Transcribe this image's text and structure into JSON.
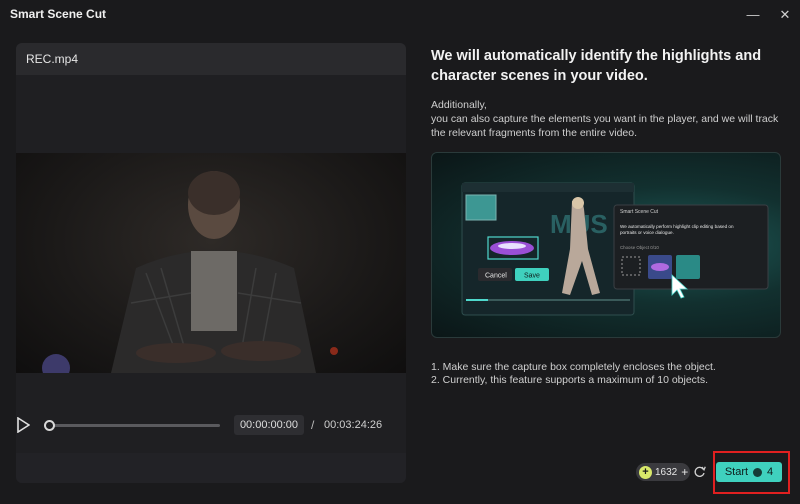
{
  "window": {
    "title": "Smart Scene Cut",
    "minimize_glyph": "—",
    "close_glyph": "✕"
  },
  "player": {
    "filename": "REC.mp4",
    "current_time": "00:00:00:00",
    "time_separator": "/",
    "total_time": "00:03:24:26",
    "progress": 0.0
  },
  "info": {
    "heading": "We will automatically identify the highlights and character scenes in your video.",
    "desc_line1": "Additionally,",
    "desc_line2": "you can also capture the elements you want in the player, and we will track the relevant fragments from the entire video."
  },
  "preview": {
    "cancel_label": "Cancel",
    "save_label": "Save",
    "popup_title": "Smart Scene Cut",
    "popup_text": "We automatically perform highlight clip editing based on portraits or voice dialogue.",
    "popup_section": "Choose Object 0/10",
    "watermark": "MUS"
  },
  "notes": {
    "line1": "1. Make sure the capture box completely encloses the object.",
    "line2": "2. Currently, this feature supports a maximum of 10 objects."
  },
  "footer": {
    "credits": "1632",
    "credits_plus": "+",
    "start_label": "Start",
    "start_cost": "4"
  },
  "colors": {
    "accent": "#3fd1be",
    "highlight_outline": "#e02020",
    "credit_icon": "#d8e86a"
  }
}
